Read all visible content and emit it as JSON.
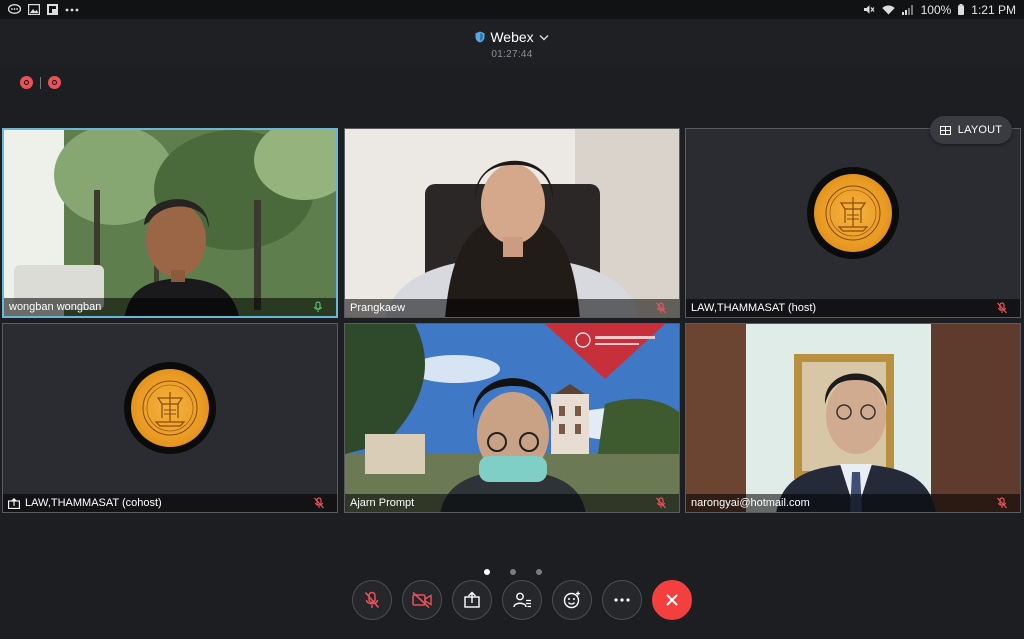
{
  "status_bar": {
    "battery": "100%",
    "time": "1:21 PM"
  },
  "header": {
    "app_title": "Webex",
    "elapsed": "01:27:44"
  },
  "layout_button": {
    "label": "LAYOUT"
  },
  "participants": [
    {
      "name": "wongban wongban",
      "mic": "on",
      "active": true,
      "video": "camera"
    },
    {
      "name": "Prangkaew",
      "mic": "muted",
      "active": false,
      "video": "camera"
    },
    {
      "name": "LAW,THAMMASAT (host)",
      "mic": "muted",
      "active": false,
      "video": "avatar"
    },
    {
      "name": "LAW,THAMMASAT (cohost)",
      "mic": "muted",
      "active": false,
      "video": "avatar",
      "sharing": true
    },
    {
      "name": "Ajarn Prompt",
      "mic": "muted",
      "active": false,
      "video": "camera"
    },
    {
      "name": "narongyai@hotmail.com",
      "mic": "muted",
      "active": false,
      "video": "camera"
    }
  ],
  "pagination": {
    "pages": 3,
    "current": 1
  },
  "controls": [
    {
      "name": "mute-button",
      "icon": "mic-muted-icon"
    },
    {
      "name": "video-button",
      "icon": "video-off-icon"
    },
    {
      "name": "share-button",
      "icon": "share-icon"
    },
    {
      "name": "participants-button",
      "icon": "participants-icon"
    },
    {
      "name": "reactions-button",
      "icon": "reactions-icon"
    },
    {
      "name": "more-button",
      "icon": "more-icon"
    },
    {
      "name": "end-call-button",
      "icon": "close-icon"
    }
  ],
  "colors": {
    "background": "#1d1e22",
    "active_speaker": "#6cb6d7",
    "muted": "#e8535a",
    "end_call": "#f3403f"
  }
}
